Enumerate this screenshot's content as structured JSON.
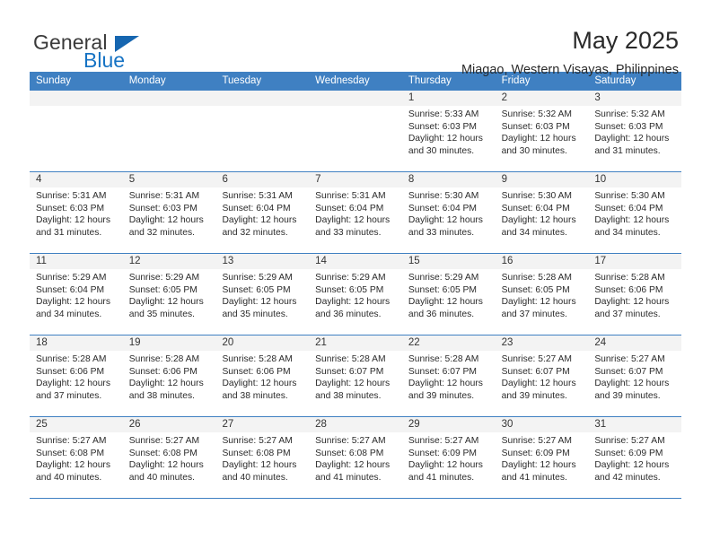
{
  "logo": {
    "word_top": "General",
    "word_bottom": "Blue",
    "accent_color": "#1673c4",
    "triangle_color": "#1666b0",
    "icon": "triangle-icon"
  },
  "header": {
    "title": "May 2025",
    "subtitle": "Miagao, Western Visayas, Philippines"
  },
  "calendar": {
    "header_bg": "#3f80c2",
    "header_text_color": "#ffffff",
    "weekday_headers": [
      "Sunday",
      "Monday",
      "Tuesday",
      "Wednesday",
      "Thursday",
      "Friday",
      "Saturday"
    ],
    "weeks": [
      [
        {
          "date": "",
          "empty": true
        },
        {
          "date": "",
          "empty": true
        },
        {
          "date": "",
          "empty": true
        },
        {
          "date": "",
          "empty": true
        },
        {
          "date": "1",
          "sunrise": "Sunrise: 5:33 AM",
          "sunset": "Sunset: 6:03 PM",
          "daylight_1": "Daylight: 12 hours",
          "daylight_2": "and 30 minutes."
        },
        {
          "date": "2",
          "sunrise": "Sunrise: 5:32 AM",
          "sunset": "Sunset: 6:03 PM",
          "daylight_1": "Daylight: 12 hours",
          "daylight_2": "and 30 minutes."
        },
        {
          "date": "3",
          "sunrise": "Sunrise: 5:32 AM",
          "sunset": "Sunset: 6:03 PM",
          "daylight_1": "Daylight: 12 hours",
          "daylight_2": "and 31 minutes."
        }
      ],
      [
        {
          "date": "4",
          "sunrise": "Sunrise: 5:31 AM",
          "sunset": "Sunset: 6:03 PM",
          "daylight_1": "Daylight: 12 hours",
          "daylight_2": "and 31 minutes."
        },
        {
          "date": "5",
          "sunrise": "Sunrise: 5:31 AM",
          "sunset": "Sunset: 6:03 PM",
          "daylight_1": "Daylight: 12 hours",
          "daylight_2": "and 32 minutes."
        },
        {
          "date": "6",
          "sunrise": "Sunrise: 5:31 AM",
          "sunset": "Sunset: 6:04 PM",
          "daylight_1": "Daylight: 12 hours",
          "daylight_2": "and 32 minutes."
        },
        {
          "date": "7",
          "sunrise": "Sunrise: 5:31 AM",
          "sunset": "Sunset: 6:04 PM",
          "daylight_1": "Daylight: 12 hours",
          "daylight_2": "and 33 minutes."
        },
        {
          "date": "8",
          "sunrise": "Sunrise: 5:30 AM",
          "sunset": "Sunset: 6:04 PM",
          "daylight_1": "Daylight: 12 hours",
          "daylight_2": "and 33 minutes."
        },
        {
          "date": "9",
          "sunrise": "Sunrise: 5:30 AM",
          "sunset": "Sunset: 6:04 PM",
          "daylight_1": "Daylight: 12 hours",
          "daylight_2": "and 34 minutes."
        },
        {
          "date": "10",
          "sunrise": "Sunrise: 5:30 AM",
          "sunset": "Sunset: 6:04 PM",
          "daylight_1": "Daylight: 12 hours",
          "daylight_2": "and 34 minutes."
        }
      ],
      [
        {
          "date": "11",
          "sunrise": "Sunrise: 5:29 AM",
          "sunset": "Sunset: 6:04 PM",
          "daylight_1": "Daylight: 12 hours",
          "daylight_2": "and 34 minutes."
        },
        {
          "date": "12",
          "sunrise": "Sunrise: 5:29 AM",
          "sunset": "Sunset: 6:05 PM",
          "daylight_1": "Daylight: 12 hours",
          "daylight_2": "and 35 minutes."
        },
        {
          "date": "13",
          "sunrise": "Sunrise: 5:29 AM",
          "sunset": "Sunset: 6:05 PM",
          "daylight_1": "Daylight: 12 hours",
          "daylight_2": "and 35 minutes."
        },
        {
          "date": "14",
          "sunrise": "Sunrise: 5:29 AM",
          "sunset": "Sunset: 6:05 PM",
          "daylight_1": "Daylight: 12 hours",
          "daylight_2": "and 36 minutes."
        },
        {
          "date": "15",
          "sunrise": "Sunrise: 5:29 AM",
          "sunset": "Sunset: 6:05 PM",
          "daylight_1": "Daylight: 12 hours",
          "daylight_2": "and 36 minutes."
        },
        {
          "date": "16",
          "sunrise": "Sunrise: 5:28 AM",
          "sunset": "Sunset: 6:05 PM",
          "daylight_1": "Daylight: 12 hours",
          "daylight_2": "and 37 minutes."
        },
        {
          "date": "17",
          "sunrise": "Sunrise: 5:28 AM",
          "sunset": "Sunset: 6:06 PM",
          "daylight_1": "Daylight: 12 hours",
          "daylight_2": "and 37 minutes."
        }
      ],
      [
        {
          "date": "18",
          "sunrise": "Sunrise: 5:28 AM",
          "sunset": "Sunset: 6:06 PM",
          "daylight_1": "Daylight: 12 hours",
          "daylight_2": "and 37 minutes."
        },
        {
          "date": "19",
          "sunrise": "Sunrise: 5:28 AM",
          "sunset": "Sunset: 6:06 PM",
          "daylight_1": "Daylight: 12 hours",
          "daylight_2": "and 38 minutes."
        },
        {
          "date": "20",
          "sunrise": "Sunrise: 5:28 AM",
          "sunset": "Sunset: 6:06 PM",
          "daylight_1": "Daylight: 12 hours",
          "daylight_2": "and 38 minutes."
        },
        {
          "date": "21",
          "sunrise": "Sunrise: 5:28 AM",
          "sunset": "Sunset: 6:07 PM",
          "daylight_1": "Daylight: 12 hours",
          "daylight_2": "and 38 minutes."
        },
        {
          "date": "22",
          "sunrise": "Sunrise: 5:28 AM",
          "sunset": "Sunset: 6:07 PM",
          "daylight_1": "Daylight: 12 hours",
          "daylight_2": "and 39 minutes."
        },
        {
          "date": "23",
          "sunrise": "Sunrise: 5:27 AM",
          "sunset": "Sunset: 6:07 PM",
          "daylight_1": "Daylight: 12 hours",
          "daylight_2": "and 39 minutes."
        },
        {
          "date": "24",
          "sunrise": "Sunrise: 5:27 AM",
          "sunset": "Sunset: 6:07 PM",
          "daylight_1": "Daylight: 12 hours",
          "daylight_2": "and 39 minutes."
        }
      ],
      [
        {
          "date": "25",
          "sunrise": "Sunrise: 5:27 AM",
          "sunset": "Sunset: 6:08 PM",
          "daylight_1": "Daylight: 12 hours",
          "daylight_2": "and 40 minutes."
        },
        {
          "date": "26",
          "sunrise": "Sunrise: 5:27 AM",
          "sunset": "Sunset: 6:08 PM",
          "daylight_1": "Daylight: 12 hours",
          "daylight_2": "and 40 minutes."
        },
        {
          "date": "27",
          "sunrise": "Sunrise: 5:27 AM",
          "sunset": "Sunset: 6:08 PM",
          "daylight_1": "Daylight: 12 hours",
          "daylight_2": "and 40 minutes."
        },
        {
          "date": "28",
          "sunrise": "Sunrise: 5:27 AM",
          "sunset": "Sunset: 6:08 PM",
          "daylight_1": "Daylight: 12 hours",
          "daylight_2": "and 41 minutes."
        },
        {
          "date": "29",
          "sunrise": "Sunrise: 5:27 AM",
          "sunset": "Sunset: 6:09 PM",
          "daylight_1": "Daylight: 12 hours",
          "daylight_2": "and 41 minutes."
        },
        {
          "date": "30",
          "sunrise": "Sunrise: 5:27 AM",
          "sunset": "Sunset: 6:09 PM",
          "daylight_1": "Daylight: 12 hours",
          "daylight_2": "and 41 minutes."
        },
        {
          "date": "31",
          "sunrise": "Sunrise: 5:27 AM",
          "sunset": "Sunset: 6:09 PM",
          "daylight_1": "Daylight: 12 hours",
          "daylight_2": "and 42 minutes."
        }
      ]
    ]
  }
}
